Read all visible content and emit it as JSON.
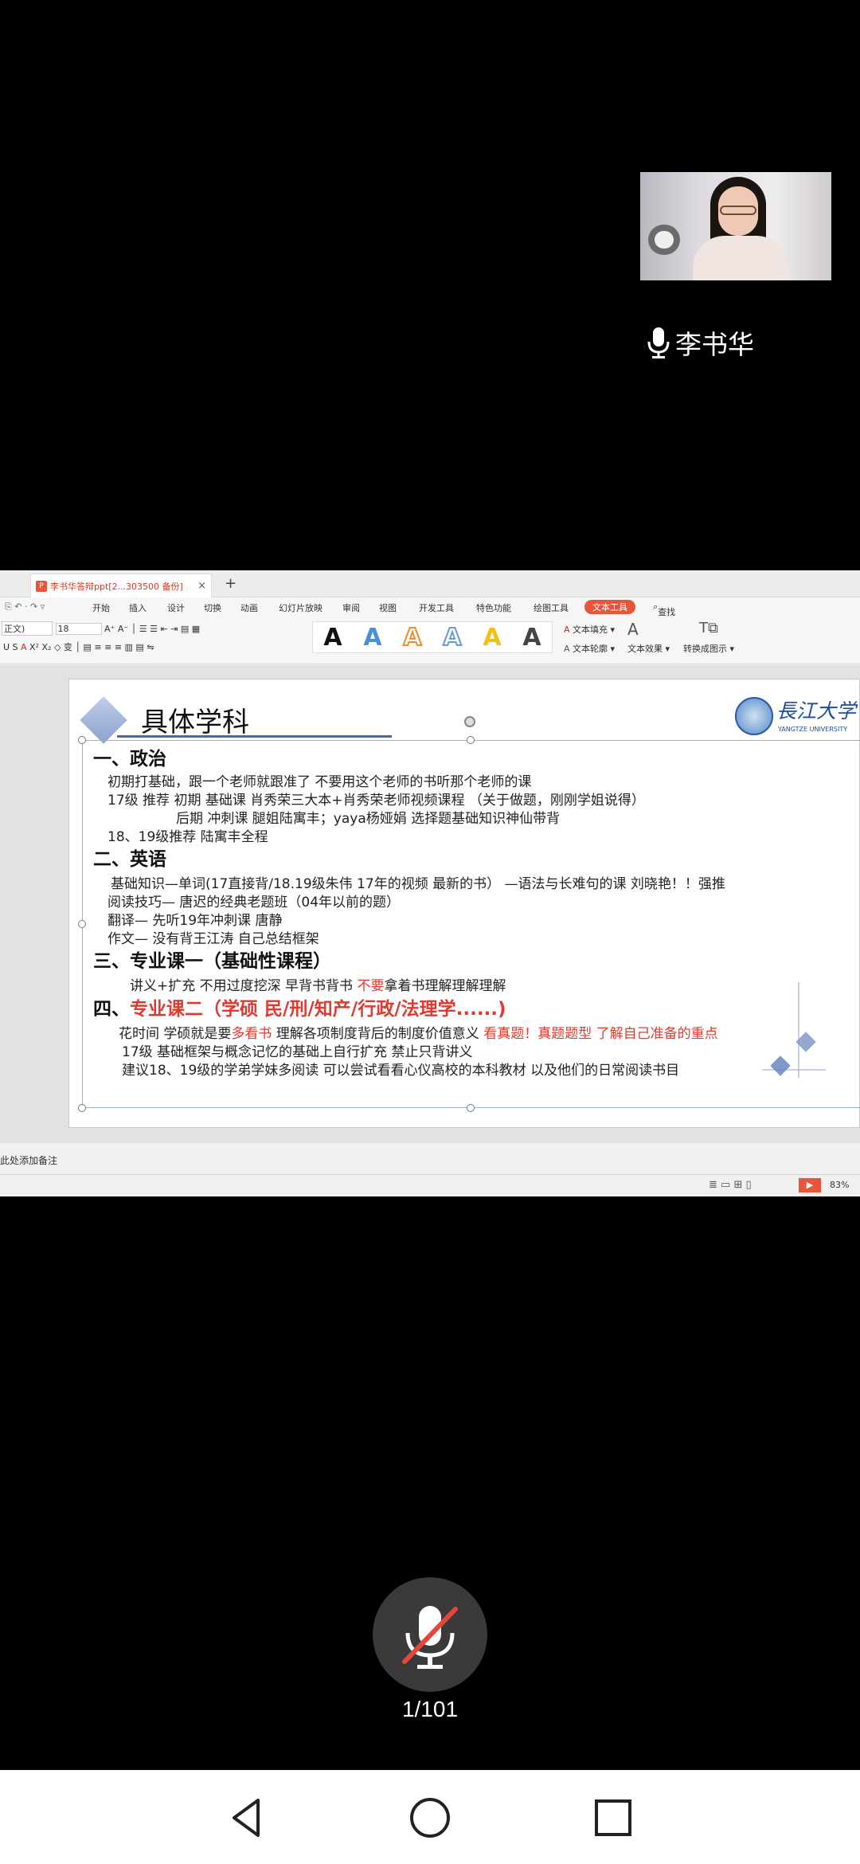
{
  "speaker": {
    "name": "李书华"
  },
  "screen": {
    "tab_title": "李书华答辩ppt[2...303500 备份]",
    "menu": [
      "开始",
      "插入",
      "设计",
      "切换",
      "动画",
      "幻灯片放映",
      "审阅",
      "视图",
      "开发工具",
      "特色功能",
      "绘图工具",
      "文本工具",
      "查找"
    ],
    "active_menu": "文本工具",
    "ribbon": {
      "font_name": "正文)",
      "font_size": "18",
      "text_fill": "文本填充",
      "text_outline": "文本轮廓",
      "text_effect": "文本效果",
      "convert": "转换成图示",
      "style_glyph": "A"
    },
    "slide": {
      "title": "具体学科",
      "logo_cn": "長江大学",
      "logo_en": "YANGTZE UNIVERSITY",
      "sections": {
        "s1": "一、政治",
        "s1_l1": "初期打基础，跟一个老师就跟准了  不要用这个老师的书听那个老师的课",
        "s1_l2": "17级 推荐  初期 基础课  肖秀荣三大本+肖秀荣老师视频课程 （关于做题，刚刚学姐说得）",
        "s1_l3": "后期 冲刺课  腿姐陆寓丰；yaya杨娅娟  选择题基础知识神仙带背",
        "s1_l4": "18、19级推荐  陆寓丰全程",
        "s2": "二、英语",
        "s2_l1": "基础知识—单词(17直接背/18.19级朱伟 17年的视频 最新的书）   —语法与长难句的课  刘晓艳！！强推",
        "s2_l2": "阅读技巧— 唐迟的经典老题班（04年以前的题）",
        "s2_l3": "翻译— 先听19年冲刺课 唐静",
        "s2_l4": "作文— 没有背王江涛  自己总结框架",
        "s3": "三、专业课一（基础性课程）",
        "s3_l1a": "讲义+扩充 不用过度挖深  早背书背书  ",
        "s3_l1b": "不要",
        "s3_l1c": "拿着书理解理解理解",
        "s4a": "四、",
        "s4b": "专业课二（学硕 民/刑/知产/行政/法理学......)",
        "s4_l1a": "花时间  学硕就是要",
        "s4_l1b": "多看书",
        "s4_l1c": "  理解各项制度背后的制度价值意义  ",
        "s4_l1d": "看真题！真题题型 了解自己准备的重点",
        "s4_l2": "17级 基础框架与概念记忆的基础上自行扩充   禁止只背讲义",
        "s4_l3": "建议18、19级的学弟学妹多阅读    可以尝试看看心仪高校的本科教材 以及他们的日常阅读书目"
      }
    },
    "notes_placeholder": "此处添加备注",
    "zoom": "83%"
  },
  "meeting": {
    "page_counter": "1/101",
    "mic_muted": true
  }
}
